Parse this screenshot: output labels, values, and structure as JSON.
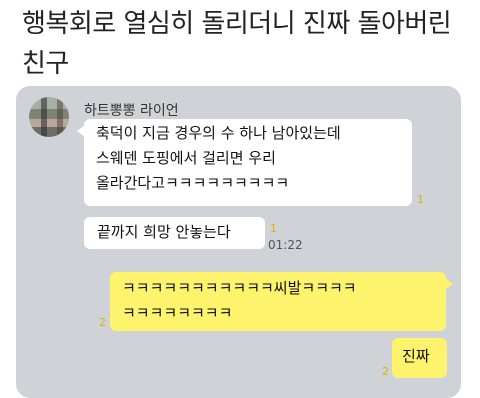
{
  "post": {
    "title": "행복회로 열심히 돌리더니 진짜 돌아버린 친구"
  },
  "chat": {
    "sender_name": "하트뽕뽕 라이언",
    "messages": [
      {
        "lines": [
          "축덕이 지금 경우의 수 하나 남아있는데",
          "스웨덴 도핑에서 걸리면 우리",
          "올라간다고ㅋㅋㅋㅋㅋㅋㅋㅋㅋ"
        ],
        "unread": "1",
        "time": ""
      },
      {
        "lines": [
          "끝까지 희망 안놓는다"
        ],
        "unread": "1",
        "time": "01:22"
      },
      {
        "lines": [
          "ㅋㅋㅋㅋㅋㅋㅋㅋㅋㅋㅋ씨발ㅋㅋㅋㅋ",
          "ㅋㅋㅋㅋㅋㅋㅋㅋ"
        ],
        "unread": "2",
        "time": ""
      },
      {
        "lines": [
          "진짜"
        ],
        "unread": "2",
        "time": ""
      }
    ]
  }
}
